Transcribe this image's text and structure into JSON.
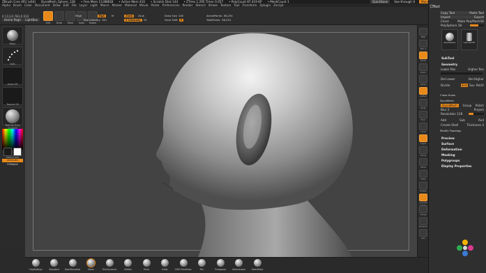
{
  "titlebar": {
    "app": "ZBrush Core 4R1 (x64)",
    "doc": "DynaMesh_Sphere_128",
    "free_mem": "• Free Mem 13.888GB",
    "active_mem": "• Active Mem 410",
    "scratch": "• Scratch Disk 144",
    "timer": "• ZTime 1.295 Timer 0.057",
    "poly": "• PolyCount 87.419 KP",
    "mesh": "• MeshCount 1",
    "quicksave": "QuickSave",
    "see_through": "See-through",
    "see_through_value": "0",
    "menus": "Menus",
    "default_script": "DefaultZScript"
  },
  "menubar": [
    "Alpha",
    "Brush",
    "Color",
    "Document",
    "Draw",
    "Edit",
    "File",
    "Layer",
    "Light",
    "Macro",
    "Marker",
    "Material",
    "Movie",
    "Picker",
    "Preferences",
    "Render",
    "Stencil",
    "Stroke",
    "Texture",
    "Tool",
    "Transform",
    "Zplugin",
    "Zscript"
  ],
  "toolbar": {
    "coords": "0.113,0.783,0.032",
    "home_page": "Home Page",
    "lightbox": "LightBox",
    "buttons": [
      "Edit",
      "Draw",
      "Move",
      "Scale",
      "Rotate"
    ],
    "mrgb": "Mrgb",
    "rgb": "Rgb",
    "m": "M",
    "zadd": "Zadd",
    "zsub": "Zsub",
    "rgb_intensity_label": "Rgb Intensity",
    "rgb_intensity": "100",
    "z_intensity_label": "Z Intensity",
    "z_intensity": "25",
    "draw_size_label": "Draw Size",
    "draw_size": "148",
    "focal_shift_label": "Focal Shift",
    "focal_shift": "0",
    "active_points_label": "ActivePoints:",
    "active_points": "86,254",
    "total_points_label": "TotalPoints:",
    "total_points": "86,254"
  },
  "leftpanel": {
    "items": [
      "Move",
      "Dots",
      "Alpha Off",
      "Texture Off",
      "MatCap Gray"
    ],
    "gradient": "Gradient",
    "switch": "SwitchColor",
    "alternate": "Alternate",
    "fill_object": "FillObject"
  },
  "rightstrip": [
    "BPR",
    "SPix 3",
    "Scroll",
    "Zoom",
    "Actual",
    "AAHalf",
    "Persp",
    "Floor",
    "Local",
    "L.Sym",
    "Frame",
    "Move",
    "Scale",
    "Rotate",
    "Line Fill PolyF",
    "Transp",
    "Dynamic",
    "Solo"
  ],
  "tray": {
    "title": "Tool",
    "row1": [
      "Copy Tool",
      "Paste Tool"
    ],
    "row2": [
      "Import",
      "Export"
    ],
    "clone": "Clone",
    "make_polymesh": "Make PolyMesh3D",
    "polysphere": "PolySphere",
    "polysphere_value": "18",
    "tools": [
      "PolySphere",
      "Cylinder3D"
    ],
    "subtool": "SubTool",
    "geometry": "Geometry",
    "lower_res": "Lower Res",
    "higher_res": "Higher Res",
    "del_lower": "Del Lower",
    "del_higher": "Del Higher",
    "divide": "Divide",
    "smt": "Smt",
    "suv": "Suv",
    "reuv": "ReUV",
    "closeholes": "Close Holes",
    "dynamesh": "DynaMesh",
    "group": "Group",
    "polish": "Polish",
    "blur": "Blur",
    "project": "Project",
    "blur_value": "2",
    "resolution_label": "Resolution",
    "resolution": "128",
    "add": "Add",
    "sub": "Sub",
    "and": "And",
    "create_shell": "Create Shell",
    "thickness_label": "Thickness",
    "thickness": "4",
    "modify_topology": "Modify Topology",
    "sections": [
      "Preview",
      "Surface",
      "Deformation",
      "Masking",
      "Polygroups",
      "Display Properties"
    ]
  },
  "shelf": {
    "brushes": [
      "ClayBuildup",
      "Standard",
      "DamStandard",
      "Move",
      "TrimDynamic",
      "hPolish",
      "Pinch",
      "Inflat",
      "IMM Primitives",
      "Pen",
      "Transpose",
      "SelectLasso",
      "SelectRect"
    ],
    "active": "Move"
  },
  "colors": {
    "accent": "#e8891a",
    "bg": "#2a2a2a",
    "canvas": "#434343"
  }
}
